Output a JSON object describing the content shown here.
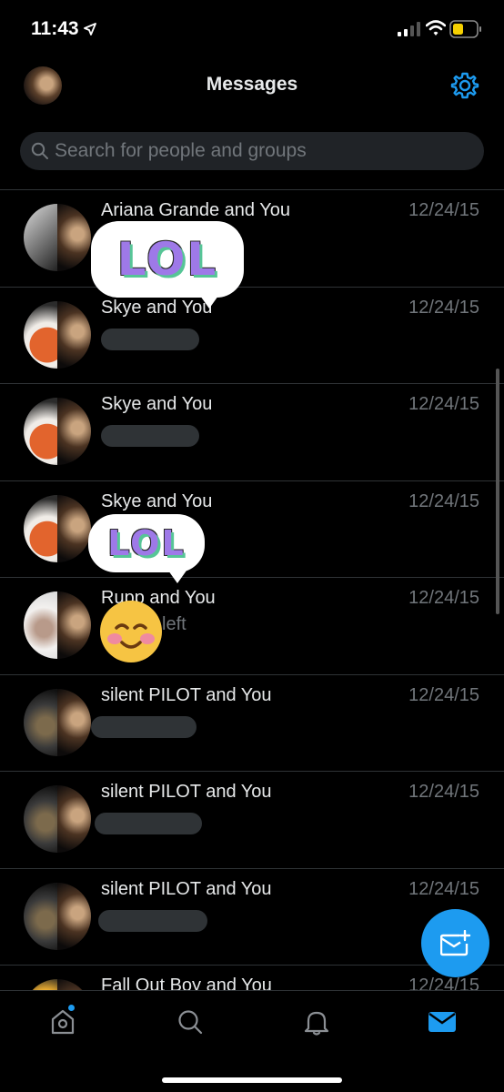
{
  "status_bar": {
    "time": "11:43"
  },
  "header": {
    "title": "Messages"
  },
  "search": {
    "placeholder": "Search for people and groups"
  },
  "conversations": [
    {
      "title": "Ariana Grande and You",
      "date": "12/24/15"
    },
    {
      "title": "Skye and You",
      "date": "12/24/15"
    },
    {
      "title": "Skye and You",
      "date": "12/24/15"
    },
    {
      "title": "Skye and You",
      "date": "12/24/15"
    },
    {
      "title": "Rupp and You",
      "date": "12/24/15",
      "preview_fragment": "left"
    },
    {
      "title": "silent PILOT and You",
      "date": "12/24/15"
    },
    {
      "title": "silent PILOT and You",
      "date": "12/24/15"
    },
    {
      "title": "silent PILOT and You",
      "date": "12/24/15"
    },
    {
      "title": "Fall Out Boy and You",
      "date": "12/24/15"
    }
  ],
  "stickers": {
    "lol_text": "LOL"
  },
  "colors": {
    "accent": "#1d9bf0",
    "background": "#000000",
    "divider": "#2f3336",
    "muted_text": "#71767b"
  },
  "icons": [
    "location-arrow-icon",
    "signal-icon",
    "wifi-icon",
    "battery-icon",
    "gear-icon",
    "search-icon",
    "compose-message-icon",
    "home-icon",
    "explore-search-icon",
    "bell-icon",
    "mail-icon"
  ]
}
